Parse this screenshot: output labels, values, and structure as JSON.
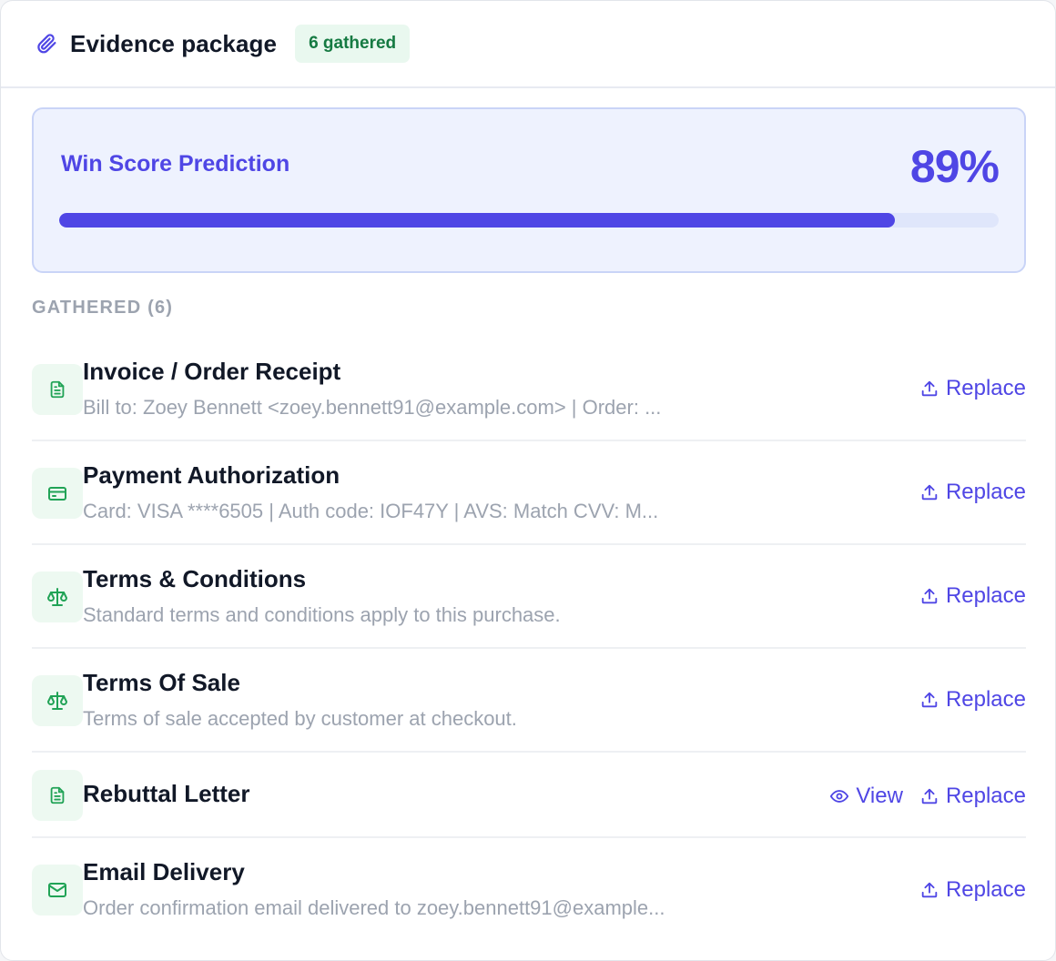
{
  "header": {
    "title": "Evidence package",
    "badge": "6 gathered"
  },
  "score": {
    "label": "Win Score Prediction",
    "value_text": "89%",
    "progress_percent": 89
  },
  "colors": {
    "accent": "#4f46e5",
    "success": "#157a42",
    "success_bg": "#e9f8ef",
    "muted": "#9ca3af"
  },
  "section_label": "GATHERED (6)",
  "items": [
    {
      "icon": "document-icon",
      "name": "Invoice / Order Receipt",
      "desc": "Bill to: Zoey Bennett <zoey.bennett91@example.com> | Order: ...",
      "has_view": false,
      "replace_label": "Replace"
    },
    {
      "icon": "credit-card-icon",
      "name": "Payment Authorization",
      "desc": "Card: VISA ****6505 | Auth code: IOF47Y | AVS: Match CVV: M...",
      "has_view": false,
      "replace_label": "Replace"
    },
    {
      "icon": "scale-icon",
      "name": "Terms & Conditions",
      "desc": "Standard terms and conditions apply to this purchase.",
      "has_view": false,
      "replace_label": "Replace"
    },
    {
      "icon": "scale-icon",
      "name": "Terms Of Sale",
      "desc": "Terms of sale accepted by customer at checkout.",
      "has_view": false,
      "replace_label": "Replace"
    },
    {
      "icon": "document-icon",
      "name": "Rebuttal Letter",
      "desc": "",
      "has_view": true,
      "view_label": "View",
      "replace_label": "Replace"
    },
    {
      "icon": "mail-icon",
      "name": "Email Delivery",
      "desc": "Order confirmation email delivered to zoey.bennett91@example...",
      "has_view": false,
      "replace_label": "Replace"
    }
  ]
}
